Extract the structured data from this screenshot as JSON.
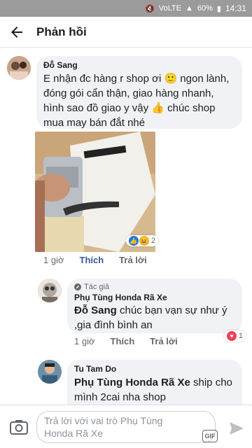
{
  "status_bar": {
    "battery": "60%",
    "time": "14:31",
    "network": "VoLTE"
  },
  "header": {
    "title": "Phản hồi"
  },
  "comments": [
    {
      "author": "Đỗ Sang",
      "text": "E nhận đc hàng r shop ơi 🙂 ngon lành, đóng gói cẩn thận, giao hàng nhanh, hình sao đồ giao y vậy 👍 chúc shop mua may bán đắt nhé",
      "reaction_count": "2",
      "time": "1 giờ",
      "like_label": "Thích",
      "reply_label": "Trả lời"
    }
  ],
  "replies": [
    {
      "badge": "Tác giả",
      "author": "Phụ Tùng Honda Rã Xe",
      "mention": "Đỗ Sang",
      "text": " chúc bạn vạn sự như ý ,gia đình bình an",
      "reaction_count": "1",
      "time": "1 giờ",
      "like_label": "Thích",
      "reply_label": "Trả lời"
    },
    {
      "author": "Tu Tam Do",
      "mention": "Phụ Tùng Honda Rã Xe",
      "text": " ship cho mình 2cai nha shop"
    }
  ],
  "composer": {
    "placeholder": "Trả lời với vai trò Phụ Tùng Honda Rã Xe",
    "gif_label": "GIF"
  },
  "colors": {
    "link": "#385898",
    "bubble": "#f0f2f5",
    "like": "#1877f2",
    "love": "#f33e58"
  }
}
